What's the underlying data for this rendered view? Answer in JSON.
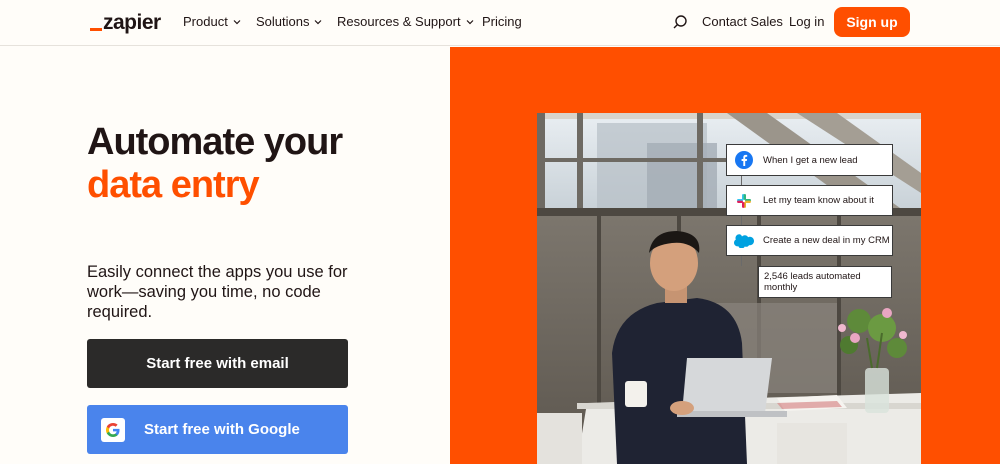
{
  "nav": {
    "logo_text": "zapier",
    "items": [
      {
        "label": "Product",
        "has_dropdown": true
      },
      {
        "label": "Solutions",
        "has_dropdown": true
      },
      {
        "label": "Resources & Support",
        "has_dropdown": true
      },
      {
        "label": "Pricing",
        "has_dropdown": false
      }
    ],
    "contact_label": "Contact Sales",
    "login_label": "Log in",
    "signup_label": "Sign up"
  },
  "hero": {
    "title_line1": "Automate your",
    "title_line2": "data entry",
    "subtitle": "Easily connect the apps you use for work—saving you time, no code required.",
    "email_button": "Start free with email",
    "google_button": "Start free with Google"
  },
  "workflow": [
    {
      "icon": "facebook-icon",
      "label": "When I get a new lead"
    },
    {
      "icon": "slack-icon",
      "label": "Let my team know about it"
    },
    {
      "icon": "salesforce-icon",
      "label": "Create a new deal in my CRM"
    }
  ],
  "stats_label": "2,546 leads automated monthly",
  "colors": {
    "brand": "#ff4f00",
    "dark_button": "#2b2a29",
    "google_button": "#4a84ec",
    "background": "#fffdf9"
  }
}
